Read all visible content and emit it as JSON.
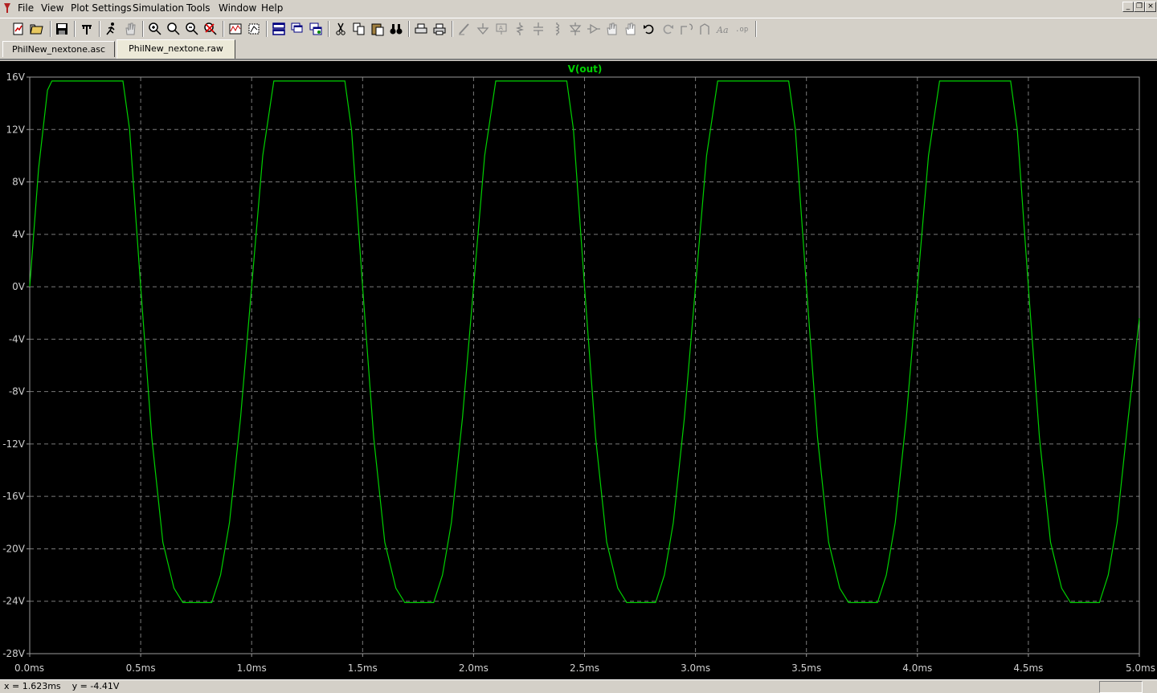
{
  "menu": {
    "items": [
      "File",
      "View",
      "Plot Settings",
      "Simulation",
      "Tools",
      "Window",
      "Help"
    ]
  },
  "window_controls": {
    "minimize": "_",
    "restore": "❐",
    "close": "×"
  },
  "toolbar": {
    "icons": [
      "new-schematic-icon",
      "open-icon",
      "save-icon",
      "control-panel-icon",
      "run-icon",
      "halt-icon",
      "zoom-in-icon",
      "zoom-area-icon",
      "zoom-out-icon",
      "zoom-cancel-icon",
      "autorange-icon",
      "zoom-full-icon",
      "tile-horizontal-icon",
      "cascade-icon",
      "tile-vertical-icon",
      "cut-icon",
      "copy-icon",
      "paste-icon",
      "find-icon",
      "print-setup-icon",
      "print-icon",
      "wire-icon",
      "ground-icon",
      "label-net-icon",
      "resistor-icon",
      "capacitor-icon",
      "inductor-icon",
      "diode-icon",
      "component-icon",
      "move-icon",
      "drag-icon",
      "undo-icon",
      "redo-icon",
      "rotate-icon",
      "mirror-icon",
      "text-icon",
      "spice-directive-icon"
    ]
  },
  "tabs": [
    {
      "label": "PhilNew_nextone.asc",
      "active": false
    },
    {
      "label": "PhilNew_nextone.raw",
      "active": true
    }
  ],
  "colors": {
    "trace": "#00d000",
    "grid": "#7a7a7a",
    "axis_text": "#d0d0d0",
    "plot_bg": "#000000"
  },
  "chart_data": {
    "type": "line",
    "title": "V(out)",
    "x_ticks": [
      "0.0ms",
      "0.5ms",
      "1.0ms",
      "1.5ms",
      "2.0ms",
      "2.5ms",
      "3.0ms",
      "3.5ms",
      "4.0ms",
      "4.5ms",
      "5.0ms"
    ],
    "y_ticks": [
      "16V",
      "12V",
      "8V",
      "4V",
      "0V",
      "-4V",
      "-8V",
      "-12V",
      "-16V",
      "-20V",
      "-24V",
      "-28V"
    ],
    "xlim": [
      0,
      5
    ],
    "ylim": [
      -28,
      16
    ],
    "grid": true,
    "series": [
      {
        "name": "V(out)",
        "x": [
          0.0,
          0.04,
          0.08,
          0.1,
          0.42,
          0.45,
          0.5,
          0.55,
          0.6,
          0.65,
          0.69,
          0.82,
          0.86,
          0.9,
          0.95,
          1.0,
          1.05,
          1.1,
          1.42,
          1.45,
          1.5,
          1.55,
          1.6,
          1.65,
          1.69,
          1.82,
          1.86,
          1.9,
          1.95,
          2.0,
          2.05,
          2.1,
          2.42,
          2.45,
          2.5,
          2.55,
          2.6,
          2.65,
          2.69,
          2.82,
          2.86,
          2.9,
          2.95,
          3.0,
          3.05,
          3.1,
          3.42,
          3.45,
          3.5,
          3.55,
          3.6,
          3.65,
          3.69,
          3.82,
          3.86,
          3.9,
          3.95,
          4.0,
          4.05,
          4.1,
          4.42,
          4.45,
          4.5,
          4.55,
          4.6,
          4.65,
          4.69,
          4.82,
          4.86,
          4.9,
          4.95,
          5.0
        ],
        "y": [
          0.0,
          9.0,
          15.0,
          15.7,
          15.7,
          12.0,
          0.0,
          -11.5,
          -19.5,
          -23.0,
          -24.1,
          -24.1,
          -22.0,
          -18.0,
          -10.0,
          0.0,
          10.0,
          15.7,
          15.7,
          12.0,
          0.0,
          -11.5,
          -19.5,
          -23.0,
          -24.1,
          -24.1,
          -22.0,
          -18.0,
          -10.0,
          0.0,
          10.0,
          15.7,
          15.7,
          12.0,
          0.0,
          -11.5,
          -19.5,
          -23.0,
          -24.1,
          -24.1,
          -22.0,
          -18.0,
          -10.0,
          0.0,
          10.0,
          15.7,
          15.7,
          12.0,
          0.0,
          -11.5,
          -19.5,
          -23.0,
          -24.1,
          -24.1,
          -22.0,
          -18.0,
          -10.0,
          0.0,
          10.0,
          15.7,
          15.7,
          12.0,
          0.0,
          -11.5,
          -19.5,
          -23.0,
          -24.1,
          -24.1,
          -22.0,
          -18.0,
          -10.0,
          -2.4
        ]
      }
    ]
  },
  "status": {
    "readout": "x = 1.623ms    y = -4.41V"
  }
}
